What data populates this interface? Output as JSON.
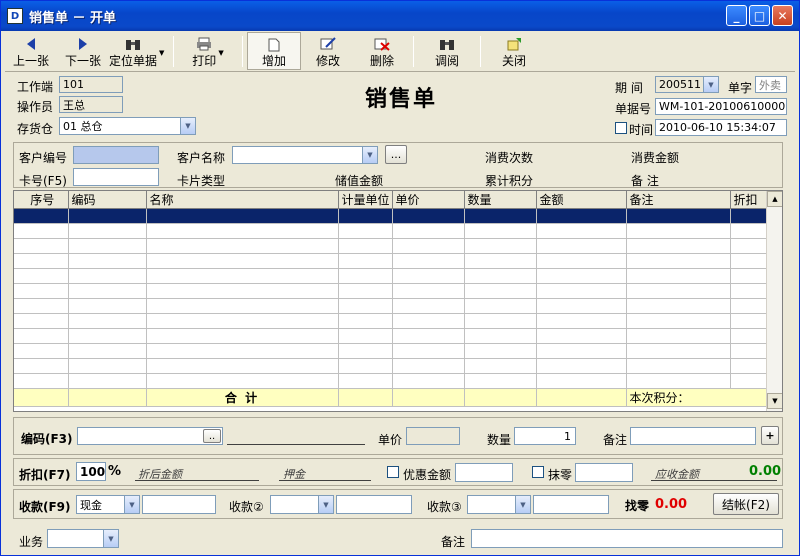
{
  "window": {
    "title": "销售单 － 开单",
    "icon": "document-icon"
  },
  "toolbar": {
    "prev": "上一张",
    "next": "下一张",
    "locate": "定位单据",
    "print": "打印",
    "add": "增加",
    "edit": "修改",
    "delete": "删除",
    "review": "调阅",
    "close": "关闭"
  },
  "header": {
    "form_title": "销售单",
    "terminal_label": "工作端",
    "terminal_value": "101",
    "operator_label": "操作员",
    "operator_value": "王总",
    "warehouse_label": "存货仓",
    "warehouse_value": "01 总仓",
    "period_label": "期  间",
    "period_value": "200511",
    "prefix_label": "单字",
    "prefix_value": "外卖",
    "doc_no_label": "单据号",
    "doc_no_value": "WM-101-201006100001",
    "time_label": "时间",
    "time_value": "2010-06-10 15:34:07"
  },
  "customer": {
    "code_label": "客户编号",
    "code_value": "",
    "name_label": "客户名称",
    "name_value": "",
    "more_button": "...",
    "card_label": "卡号(F5)",
    "card_value": "",
    "card_type_label": "卡片类型",
    "stored_value_label": "储值金额",
    "visit_count_label": "消费次数",
    "points_label": "累计积分",
    "spend_amount_label": "消费金额",
    "remark_label": "备  注"
  },
  "grid": {
    "columns": [
      "序号",
      "编码",
      "名称",
      "计量单位",
      "单价",
      "数量",
      "金额",
      "备注",
      "折扣"
    ],
    "total_label": "合    计",
    "points_label": "本次积分："
  },
  "entry": {
    "code_label": "编码(F3)",
    "code_button": "..",
    "price_label": "单价",
    "qty_label": "数量",
    "qty_value": "1",
    "remark_label": "备注",
    "add_button": "+"
  },
  "discount": {
    "label": "折扣(F7)",
    "value": "100",
    "percent": "%",
    "after_amount_label": "折后金额",
    "commission_label": "押金",
    "promo_label": "优惠金额",
    "erase_label": "抹零",
    "receivable_label": "应收金额",
    "receivable_value": "0.00"
  },
  "payment": {
    "label": "收款(F9)",
    "method1": "现金",
    "method2_label": "收款②",
    "method3_label": "收款③",
    "change_label": "找零",
    "change_value": "0.00",
    "checkout_button": "结帐(F2)"
  },
  "footer": {
    "business_label": "业务",
    "remark_label": "备注"
  },
  "colors": {
    "selected_row": "#0a246a",
    "total_row": "#ffffc0",
    "customer_code_bg": "#b6c8ec"
  }
}
